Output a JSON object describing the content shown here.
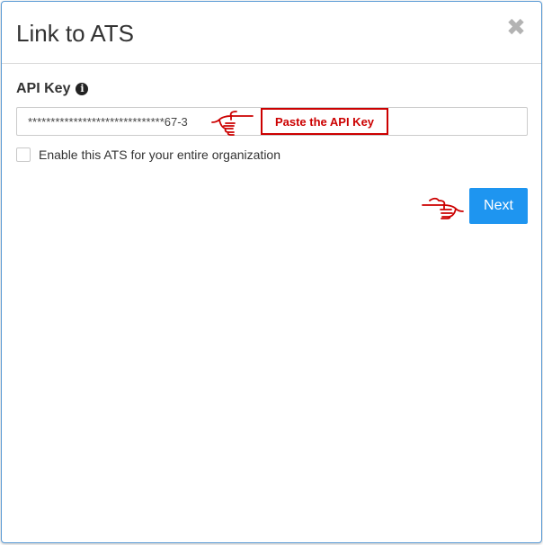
{
  "dialog": {
    "title": "Link to ATS",
    "close_glyph": "✖"
  },
  "api_key": {
    "label": "API Key",
    "info_icon": "info-circle-icon",
    "info_glyph": "i",
    "value": "******************************67-3"
  },
  "annotation": {
    "text": "Paste the API Key",
    "color": "#cc0000"
  },
  "checkbox": {
    "label": "Enable this ATS for your entire organization",
    "checked": false
  },
  "next_button": {
    "label": "Next",
    "color": "#1e95f0"
  }
}
